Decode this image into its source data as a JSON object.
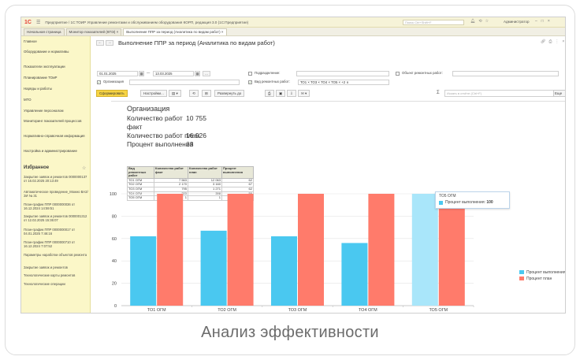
{
  "caption": "Анализ эффективности",
  "titlebar": {
    "logo": "1С",
    "title": "Предприятие / 1С:ТОИР Управление ремонтами и обслуживанием оборудования КОРП, редакция 3.0 (1С:Предприятие)",
    "search_placeholder": "Поиск Ctrl+Shift+F",
    "user": "Администратор"
  },
  "tabs": [
    {
      "label": "Начальная страница"
    },
    {
      "label": "Монитор показателей (КПЭ) ×"
    },
    {
      "label": "Выполнение ППР за период (Аналитика по видам работ) ×"
    }
  ],
  "sidebar": {
    "items": [
      {
        "label": "Главное"
      },
      {
        "label": "Оборудование и нормативы"
      },
      {
        "label": "Показатели эксплуатации"
      },
      {
        "label": "Планирование ТОиР"
      },
      {
        "label": "Наряды и работы"
      },
      {
        "label": "МТО"
      },
      {
        "label": "Управление персоналом"
      },
      {
        "label": "Мониторинг показателей процессов"
      },
      {
        "label": "Нормативно-справочная информация"
      },
      {
        "label": "Настройка и администрирование"
      }
    ],
    "favorites_title": "Избранное",
    "favorites": [
      {
        "label": "Закрытие заявок и ремонтов 0000000137 от 16.02.2025 20:13:49"
      },
      {
        "label": "Автоматическое проведение_Можно ВАЗ/ЗИ № 31"
      },
      {
        "label": "План-график ППР 0000000036 от 16.12.2024 14:59:51"
      },
      {
        "label": "Закрытие заявок и ремонтов 0000001312 от 12.02.2025 15:36:07"
      },
      {
        "label": "План-график ППР 0000000017 от 04.01.2025 7:46:16"
      },
      {
        "label": "План-график ППР 0000000710 от 16.12.2024 7:07:52"
      },
      {
        "label": "Параметры наработки объектов ремонта"
      },
      {
        "label": "Закрытие заявок и ремонтов"
      },
      {
        "label": "Технологические карты ремонтов"
      },
      {
        "label": "Технологические операции"
      }
    ]
  },
  "content": {
    "title": "Выполнение ППР за период (Аналитика по видам работ)",
    "date_from": "01.01.2025",
    "date_to": "13.03.2025",
    "dash": "—",
    "ellipsis": "...",
    "subdivision_label": "Подразделение:",
    "org_label": "Организация",
    "repair_object_label": "Объект ремонтных работ:",
    "work_types_label": "Вид ремонтных работ:",
    "work_types_value": "ТО1 ×  ТО3 ×  ТО4 ×  ТО5 ×  +2 ∨",
    "toolbar": {
      "generate": "Сформировать",
      "settings": "Настройки...",
      "expand": "Развернуть до",
      "search_placeholder": "Искать в отчёте (Ctrl+F)",
      "more": "Еще"
    }
  },
  "report": {
    "organization": "Организация",
    "stats": [
      {
        "label": "Количество работ",
        "value": "10 755"
      },
      {
        "label": "факт",
        "value": ""
      },
      {
        "label": "Количество работ план",
        "value": "16 926"
      },
      {
        "label": "Процент выполнения",
        "value": "63"
      }
    ],
    "table": {
      "headers": [
        "Вид ремонтных работ",
        "Количество работ факт",
        "Количество работ план",
        "Процент выполнения"
      ],
      "rows": [
        [
          "ТО1 ОГМ",
          "7 563",
          "12 063",
          "62"
        ],
        [
          "ТО2 ОГМ",
          "2 170",
          "3 160",
          "67"
        ],
        [
          "ТО3 ОГМ",
          "795",
          "1 271",
          "62"
        ],
        [
          "ТО4 ОГМ",
          "223",
          "398",
          "56"
        ],
        [
          "ТО5 ОГМ",
          "1",
          "1",
          "100"
        ]
      ]
    }
  },
  "tooltip": {
    "title": "ТО5 ОГМ",
    "label": "Процент выполнения:",
    "value": "100"
  },
  "chart_data": {
    "type": "bar",
    "categories": [
      "ТО1 ОГМ",
      "ТО2 ОГМ",
      "ТО3 ОГМ",
      "ТО4 ОГМ",
      "ТО5 ОГМ"
    ],
    "series": [
      {
        "name": "Процент выполнения",
        "values": [
          62,
          67,
          62,
          56,
          100
        ],
        "color": "#4ac8f0"
      },
      {
        "name": "Процент план",
        "values": [
          100,
          100,
          100,
          100,
          100
        ],
        "color": "#ff7b6b"
      }
    ],
    "yticks": [
      "0",
      "20",
      "40",
      "60",
      "80",
      "100"
    ],
    "ylim": [
      0,
      100
    ],
    "grid": true,
    "legend_position": "right",
    "highlighted_category": "ТО5 ОГМ"
  }
}
